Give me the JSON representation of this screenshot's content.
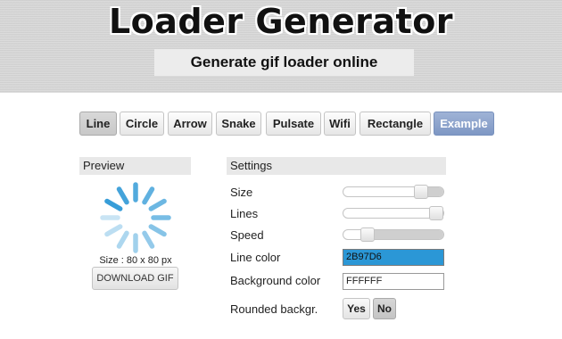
{
  "header": {
    "title": "Loader Generator",
    "subtitle": "Generate gif loader online"
  },
  "tabs": [
    {
      "label": "Line",
      "active": true
    },
    {
      "label": "Circle",
      "active": false
    },
    {
      "label": "Arrow",
      "active": false
    },
    {
      "label": "Snake",
      "active": false
    },
    {
      "label": "Pulsate",
      "active": false
    },
    {
      "label": "Wifi",
      "active": false
    },
    {
      "label": "Rectangle",
      "active": false
    },
    {
      "label": "Example",
      "active": false
    }
  ],
  "preview": {
    "heading": "Preview",
    "size_text": "Size : 80 x 80 px",
    "download_label": "DOWNLOAD GIF",
    "line_color": "#2b97d6",
    "line_count": 12
  },
  "settings": {
    "heading": "Settings",
    "size_label": "Size",
    "size_level": 0.82,
    "lines_label": "Lines",
    "lines_level": 1.0,
    "speed_label": "Speed",
    "speed_level": 0.2,
    "line_color_label": "Line color",
    "line_color_value": "2B97D6",
    "background_color_label": "Background color",
    "background_color_value": "FFFFFF",
    "rounded_label": "Rounded backgr.",
    "yes_label": "Yes",
    "no_label": "No",
    "rounded_selected": "No"
  }
}
